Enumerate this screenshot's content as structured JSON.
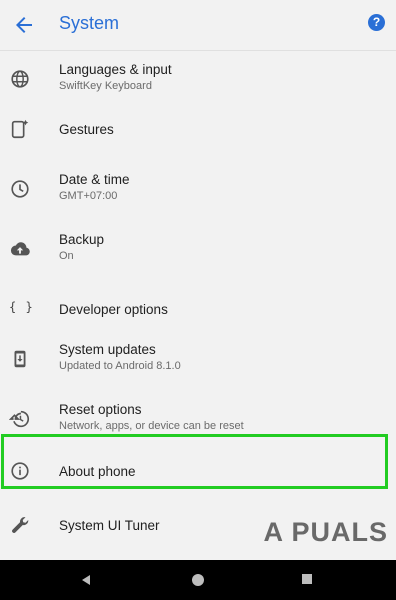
{
  "appbar": {
    "title": "System",
    "back_icon": "arrow-left-icon",
    "help_icon": "help-icon",
    "help_glyph": "?"
  },
  "items": [
    {
      "label": "Languages & input",
      "sub": "SwiftKey Keyboard",
      "icon": "globe-icon"
    },
    {
      "label": "Gestures",
      "sub": "",
      "icon": "gestures-icon"
    },
    {
      "label": "Date & time",
      "sub": "GMT+07:00",
      "icon": "clock-icon"
    },
    {
      "label": "Backup",
      "sub": "On",
      "icon": "cloud-upload-icon"
    },
    {
      "label": "Developer options",
      "sub": "",
      "icon": "braces-icon",
      "glyph": "{ }"
    },
    {
      "label": "System updates",
      "sub": "Updated to Android 8.1.0",
      "icon": "system-update-icon"
    },
    {
      "label": "Reset options",
      "sub": "Network, apps, or device can be reset",
      "icon": "restore-icon"
    },
    {
      "label": "About phone",
      "sub": "",
      "icon": "info-icon"
    },
    {
      "label": "System UI Tuner",
      "sub": "",
      "icon": "wrench-icon"
    }
  ],
  "watermark": "A  PUALS",
  "colors": {
    "accent": "#2a6fd6",
    "highlight": "#22cc22",
    "background": "#f2f2f2"
  },
  "navbar": {
    "back_icon": "nav-back-icon",
    "home_icon": "nav-home-icon",
    "recent_icon": "nav-recents-icon"
  }
}
